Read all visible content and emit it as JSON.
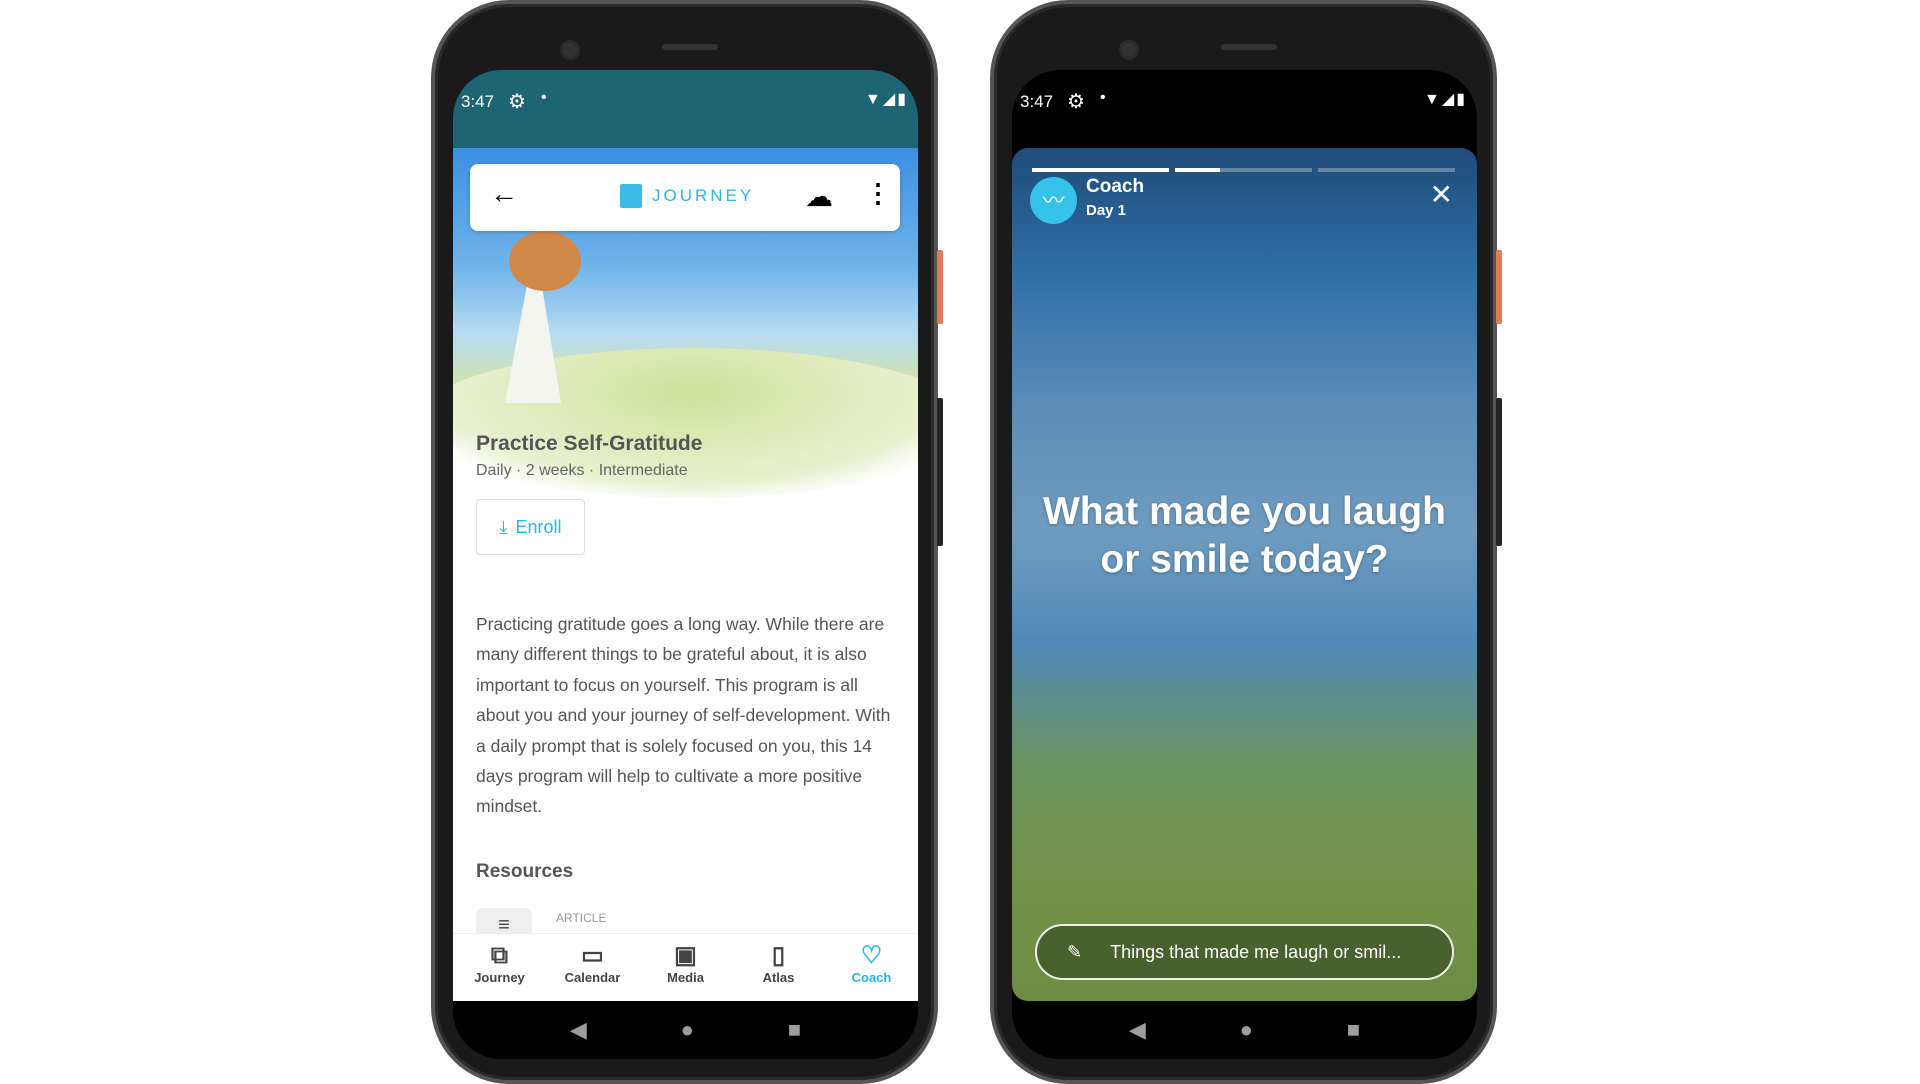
{
  "status": {
    "time": "3:47"
  },
  "journey": {
    "toolbar": {
      "brand": "JOURNEY"
    },
    "title": "Practice Self-Gratitude",
    "subtitle": "Daily · 2 weeks · Intermediate",
    "enroll": "Enroll",
    "description": "Practicing gratitude goes a long way. While there are many different things to be grateful about, it is also important to focus on yourself. This program is all about you and your journey of self-development. With a daily prompt that is solely focused on you, this 14 days program will help to cultivate a more positive mindset.",
    "resources_heading": "Resources",
    "article_label": "ARTICLE",
    "nav": [
      {
        "label": "Journey"
      },
      {
        "label": "Calendar"
      },
      {
        "label": "Media"
      },
      {
        "label": "Atlas"
      },
      {
        "label": "Coach",
        "active": true
      }
    ]
  },
  "coach": {
    "name": "Coach",
    "day": "Day 1",
    "progress": [
      1,
      0.33,
      0,
      0
    ],
    "question": "What made you laugh or smile today?",
    "input_placeholder": "Things that made me laugh or smil..."
  },
  "colors": {
    "accent": "#29b6e6",
    "status_teal": "#1d6474"
  }
}
